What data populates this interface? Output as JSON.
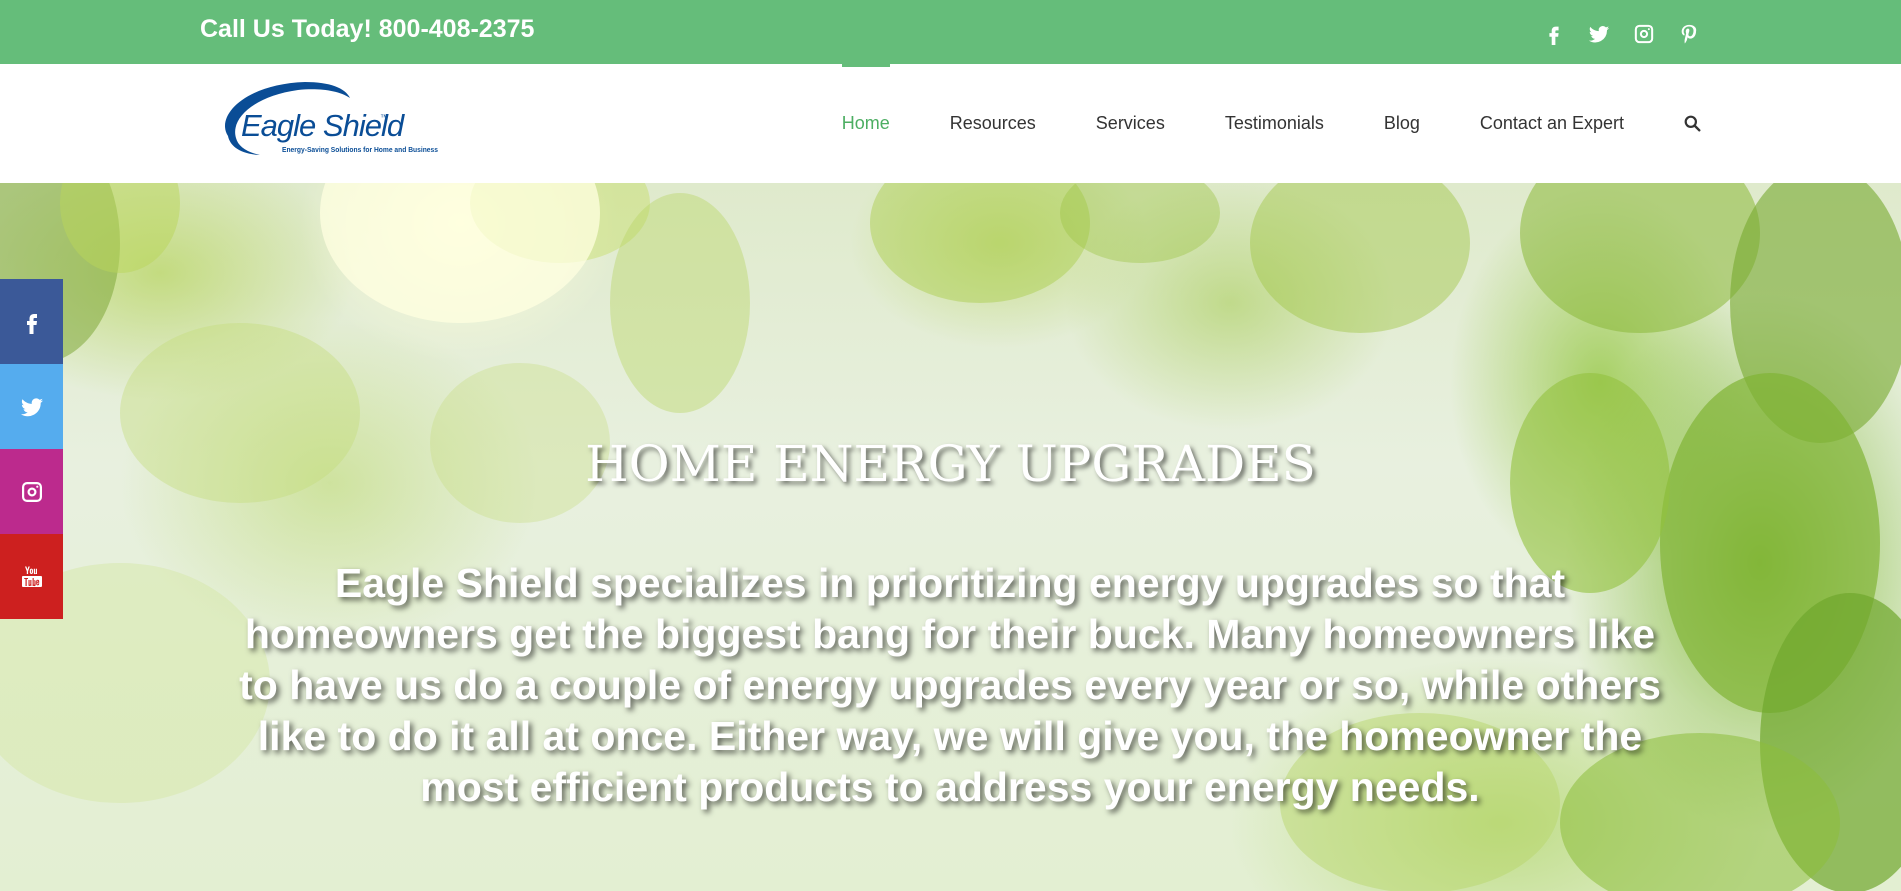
{
  "topbar": {
    "phone": "Call Us Today! 800-408-2375",
    "social": [
      "facebook-icon",
      "twitter-icon",
      "instagram-icon",
      "pinterest-icon"
    ]
  },
  "header": {
    "logo": {
      "brand": "Eagle Shield",
      "trademark": "™",
      "tagline": "Energy-Saving Solutions for Home and Business"
    },
    "nav": [
      {
        "label": "Home",
        "active": true
      },
      {
        "label": "Resources"
      },
      {
        "label": "Services"
      },
      {
        "label": "Testimonials"
      },
      {
        "label": "Blog"
      },
      {
        "label": "Contact an Expert"
      }
    ],
    "search_icon": "search-icon"
  },
  "hero": {
    "title": "HOME ENERGY UPGRADES",
    "text": "Eagle Shield specializes in prioritizing energy upgrades so that homeowners get the biggest bang for their buck. Many homeowners like to have us do a couple of energy upgrades every year or so, while others like to do it all at once. Either way, we will give you, the homeowner the most efficient products to address your energy needs."
  },
  "side_social": [
    {
      "icon": "facebook-icon",
      "color": "#3b5998"
    },
    {
      "icon": "twitter-icon",
      "color": "#55acee"
    },
    {
      "icon": "instagram-icon",
      "color": "#bc2a8d"
    },
    {
      "icon": "youtube-icon",
      "color": "#cd201f"
    }
  ],
  "colors": {
    "topbar": "#65bd7a",
    "nav_active": "#4cae62",
    "logo_blue": "#0a4d96"
  }
}
